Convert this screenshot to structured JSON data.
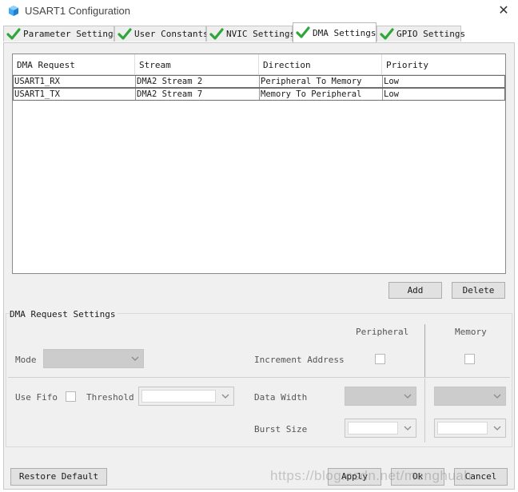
{
  "window": {
    "title": "USART1 Configuration",
    "close_glyph": "✕",
    "icon": "cube-icon"
  },
  "tabs": [
    {
      "label": "Parameter Settings",
      "icon": "green-check-icon",
      "active": false
    },
    {
      "label": "User Constants",
      "icon": "green-check-icon",
      "active": false
    },
    {
      "label": "NVIC Settings",
      "icon": "green-check-icon",
      "active": false
    },
    {
      "label": "DMA Settings",
      "icon": "green-check-icon",
      "active": true
    },
    {
      "label": "GPIO Settings",
      "icon": "green-check-icon",
      "active": false
    }
  ],
  "table": {
    "columns": [
      "DMA Request",
      "Stream",
      "Direction",
      "Priority"
    ],
    "rows": [
      {
        "request": "USART1_RX",
        "stream": "DMA2 Stream 2",
        "direction": "Peripheral To Memory",
        "priority": "Low"
      },
      {
        "request": "USART1_TX",
        "stream": "DMA2 Stream 7",
        "direction": "Memory To Peripheral",
        "priority": "Low"
      }
    ]
  },
  "actions": {
    "add": "Add",
    "delete": "Delete"
  },
  "settings": {
    "group_title": "DMA Request Settings",
    "peripheral_header": "Peripheral",
    "memory_header": "Memory",
    "mode_label": "Mode",
    "increment_address_label": "Increment Address",
    "use_fifo_label": "Use Fifo",
    "threshold_label": "Threshold",
    "data_width_label": "Data Width",
    "burst_size_label": "Burst Size"
  },
  "footer": {
    "restore_default": "Restore Default",
    "apply": "Apply",
    "ok": "Ok",
    "cancel": "Cancel",
    "watermark": "https://blog.csdn.net/menghuah"
  },
  "colors": {
    "check_green": "#2fa63a",
    "panel_bg": "#f0f0f0",
    "button_bg": "#e1e1e1"
  }
}
